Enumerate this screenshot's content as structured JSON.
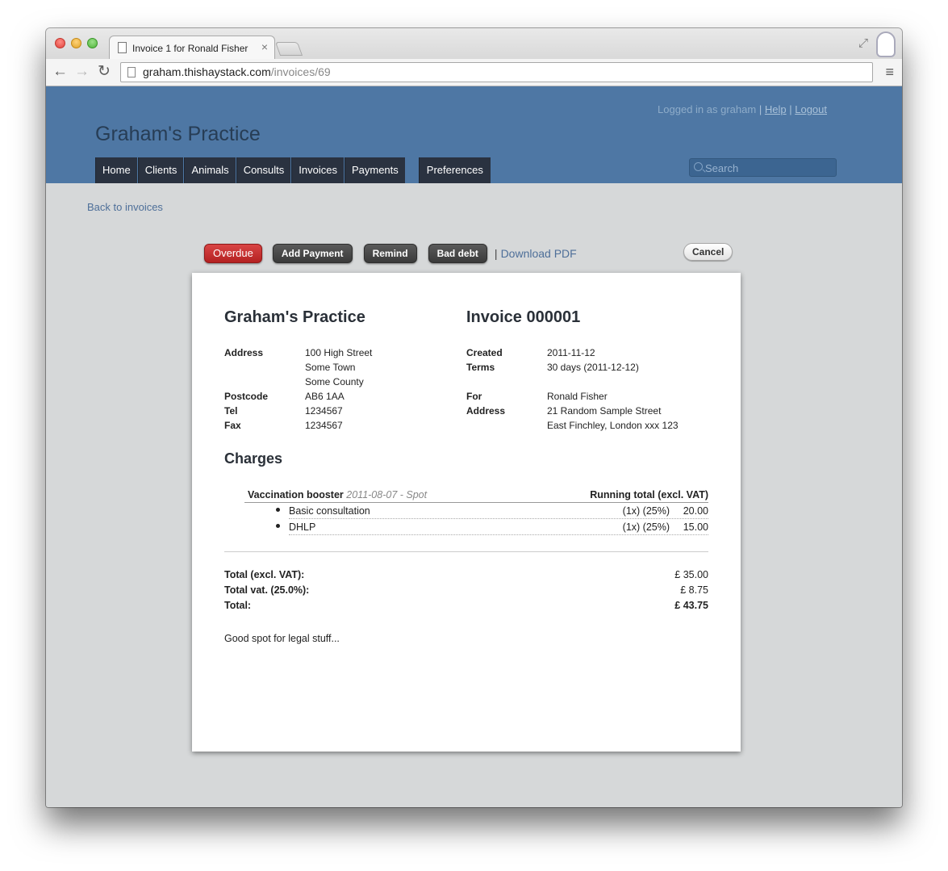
{
  "browser": {
    "tab_title": "Invoice 1 for Ronald Fisher",
    "tab_close": "×",
    "url_host": "graham.thishaystack.com",
    "url_path": "/invoices/69",
    "back": "←",
    "forward": "→",
    "reload": "↻",
    "menu": "≡",
    "resize": "⤢"
  },
  "header": {
    "logged_in_text": "Logged in as graham",
    "sep1": "|",
    "help": "Help",
    "sep2": "|",
    "logout": "Logout",
    "site_title": "Graham's Practice",
    "nav": [
      "Home",
      "Clients",
      "Animals",
      "Consults",
      "Invoices",
      "Payments"
    ],
    "preferences": "Preferences",
    "search_placeholder": "Search"
  },
  "page": {
    "back_link": "Back to invoices",
    "actions": {
      "status": "Overdue",
      "add_payment": "Add Payment",
      "remind": "Remind",
      "bad_debt": "Bad debt",
      "pipe": "|",
      "download_pdf": "Download PDF",
      "cancel": "Cancel"
    }
  },
  "invoice": {
    "practice_name": "Graham's Practice",
    "invoice_title": "Invoice 000001",
    "practice": {
      "address_label": "Address",
      "address_1": "100 High Street",
      "address_2": "Some Town",
      "address_3": "Some County",
      "postcode_label": "Postcode",
      "postcode": "AB6 1AA",
      "tel_label": "Tel",
      "tel": "1234567",
      "fax_label": "Fax",
      "fax": "1234567"
    },
    "meta": {
      "created_label": "Created",
      "created": "2011-11-12",
      "terms_label": "Terms",
      "terms": "30 days (2011-12-12)",
      "for_label": "For",
      "for": "Ronald Fisher",
      "address_label": "Address",
      "address_1": "21 Random Sample Street",
      "address_2": "East Finchley, London xxx 123"
    },
    "charges_title": "Charges",
    "consult": {
      "name": "Vaccination booster",
      "meta": "2011-08-07 - Spot",
      "running_total_label": "Running total (excl. VAT)"
    },
    "lines": [
      {
        "name": "Basic consultation",
        "qty": "(1x) (25%)",
        "amount": "20.00"
      },
      {
        "name": "DHLP",
        "qty": "(1x) (25%)",
        "amount": "15.00"
      }
    ],
    "totals": {
      "excl_label": "Total (excl. VAT):",
      "excl": "£ 35.00",
      "vat_label": "Total vat. (25.0%):",
      "vat": "£ 8.75",
      "total_label": "Total:",
      "total": "£ 43.75"
    },
    "footer_note": "Good spot for legal stuff..."
  },
  "colors": {
    "header_bg": "#4e77a4",
    "nav_bg": "#2a3240",
    "overdue": "#c62828",
    "page_bg": "#d6d8d9"
  }
}
